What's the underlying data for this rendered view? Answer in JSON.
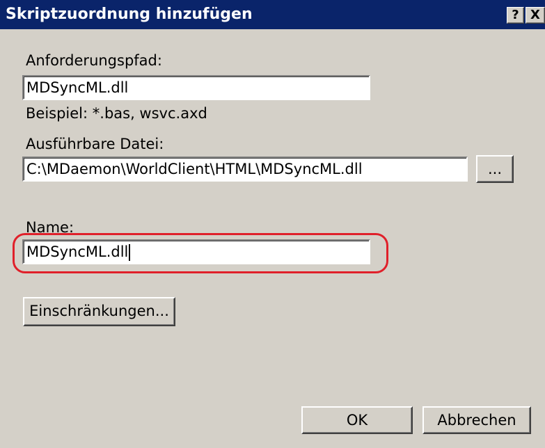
{
  "dialog": {
    "title": "Skriptzuordnung hinzufügen",
    "help_button": "?",
    "close_button": "X"
  },
  "request_path": {
    "label": "Anforderungspfad:",
    "value": "MDSyncML.dll",
    "example": "Beispiel: *.bas, wsvc.axd"
  },
  "executable": {
    "label": "Ausführbare Datei:",
    "value": "C:\\MDaemon\\WorldClient\\HTML\\MDSyncML.dll",
    "browse_button": "..."
  },
  "name": {
    "label": "Name:",
    "value": "MDSyncML.dll"
  },
  "restrictions_button": "Einschränkungen...",
  "ok_button": "OK",
  "cancel_button": "Abbrechen",
  "colors": {
    "titlebar": "#0a246a",
    "dialog_bg": "#d4d0c8",
    "highlight": "#e0202a"
  }
}
